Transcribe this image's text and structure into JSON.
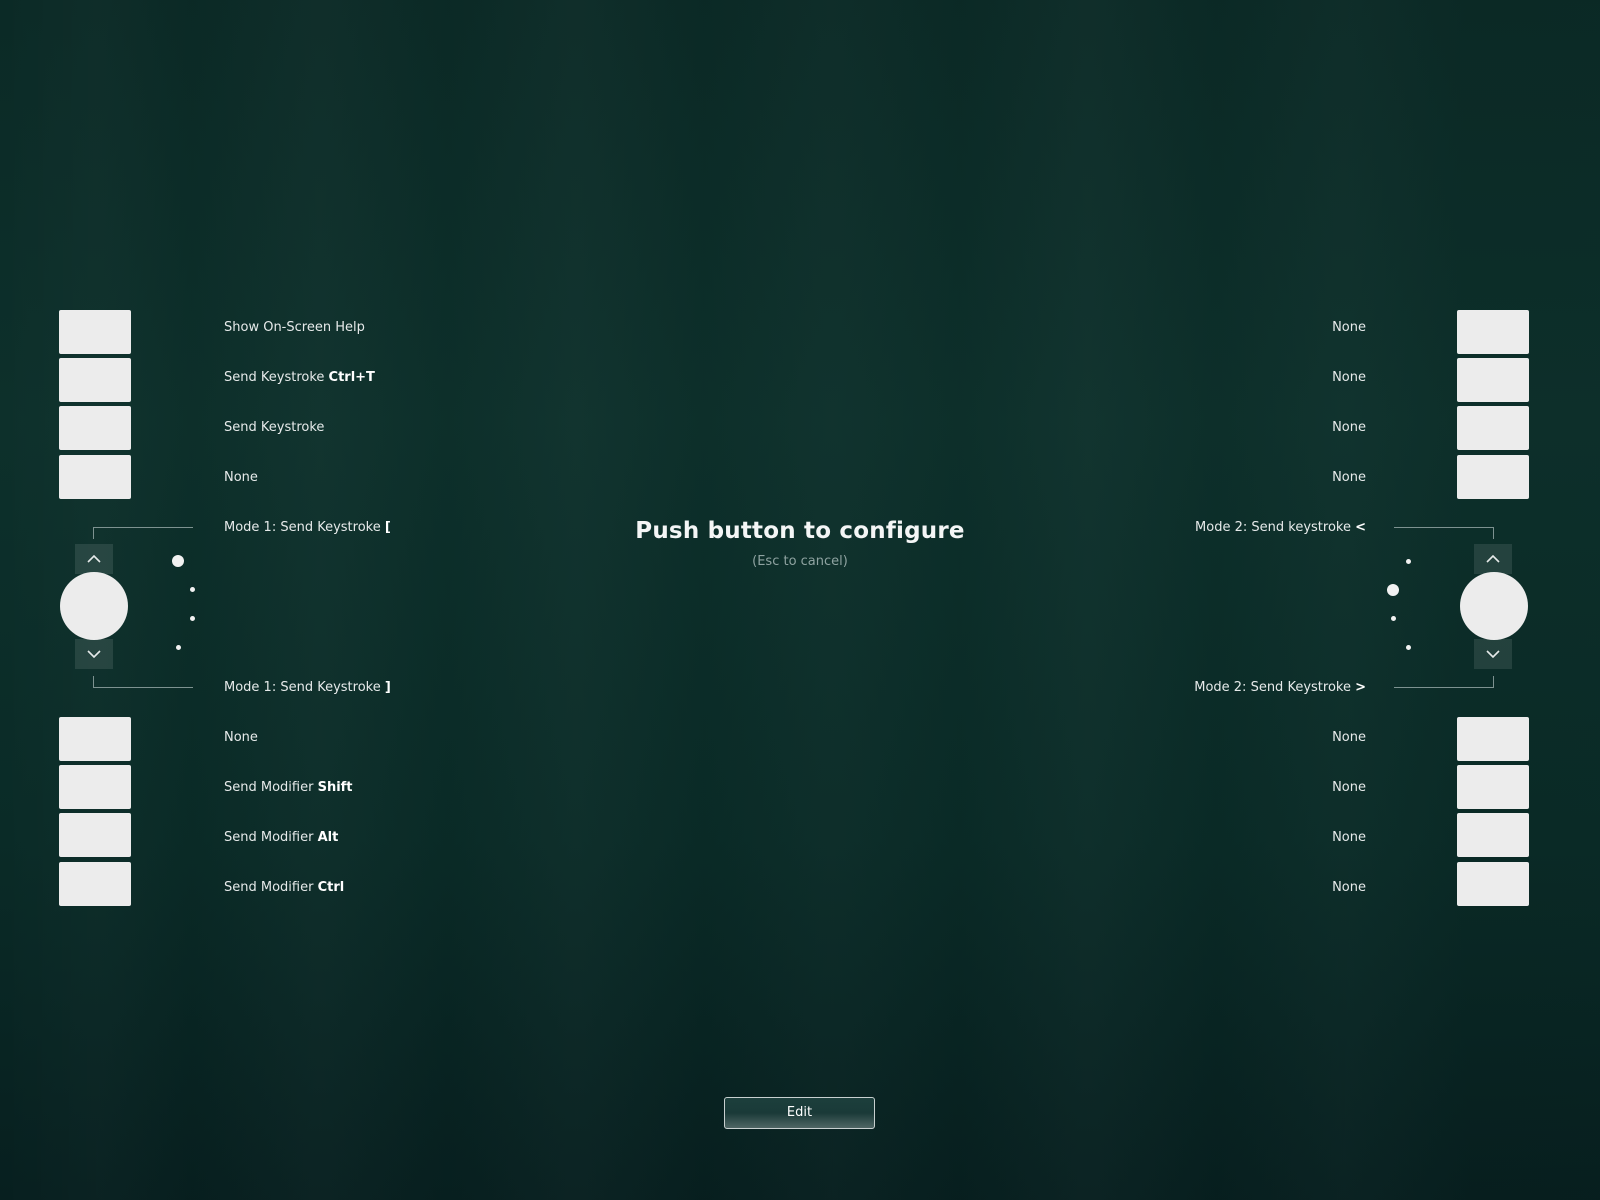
{
  "header": {
    "title": "Push button to configure",
    "subtitle": "(Esc to cancel)"
  },
  "left_top_buttons": [
    {
      "prefix": "Show On-Screen Help",
      "bold": ""
    },
    {
      "prefix": "Send Keystroke ",
      "bold": "Ctrl+T"
    },
    {
      "prefix": "Send Keystroke",
      "bold": ""
    },
    {
      "prefix": "None",
      "bold": ""
    }
  ],
  "left_wheel": {
    "up": {
      "prefix": "Mode 1: Send Keystroke ",
      "bold": "["
    },
    "down": {
      "prefix": "Mode 1: Send Keystroke ",
      "bold": "]"
    },
    "up_icon": "chevron-up-icon",
    "down_icon": "chevron-down-icon"
  },
  "left_bottom_buttons": [
    {
      "prefix": "None",
      "bold": ""
    },
    {
      "prefix": "Send Modifier ",
      "bold": "Shift"
    },
    {
      "prefix": "Send Modifier ",
      "bold": "Alt"
    },
    {
      "prefix": "Send Modifier ",
      "bold": "Ctrl"
    }
  ],
  "right_top_buttons": [
    {
      "prefix": "None",
      "bold": ""
    },
    {
      "prefix": "None",
      "bold": ""
    },
    {
      "prefix": "None",
      "bold": ""
    },
    {
      "prefix": "None",
      "bold": ""
    }
  ],
  "right_wheel": {
    "up": {
      "prefix": "Mode 2: Send keystroke ",
      "bold": "<"
    },
    "down": {
      "prefix": "Mode 2: Send Keystroke ",
      "bold": ">"
    },
    "up_icon": "chevron-up-icon",
    "down_icon": "chevron-down-icon"
  },
  "right_bottom_buttons": [
    {
      "prefix": "None",
      "bold": ""
    },
    {
      "prefix": "None",
      "bold": ""
    },
    {
      "prefix": "None",
      "bold": ""
    },
    {
      "prefix": "None",
      "bold": ""
    }
  ],
  "footer": {
    "edit_label": "Edit"
  }
}
